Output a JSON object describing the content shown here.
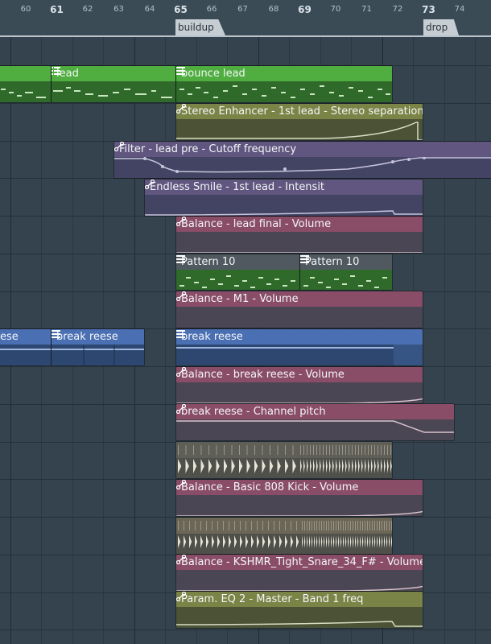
{
  "ruler": {
    "bars": [
      {
        "label": "60",
        "major": false
      },
      {
        "label": "61",
        "major": true
      },
      {
        "label": "62",
        "major": false
      },
      {
        "label": "63",
        "major": false
      },
      {
        "label": "64",
        "major": false
      },
      {
        "label": "65",
        "major": true
      },
      {
        "label": "66",
        "major": false
      },
      {
        "label": "67",
        "major": false
      },
      {
        "label": "68",
        "major": false
      },
      {
        "label": "69",
        "major": true
      },
      {
        "label": "70",
        "major": false
      },
      {
        "label": "71",
        "major": false
      },
      {
        "label": "72",
        "major": false
      },
      {
        "label": "73",
        "major": true
      },
      {
        "label": "74",
        "major": false
      }
    ],
    "markers": [
      "buildup",
      "drop"
    ]
  },
  "clips": {
    "lead_a": "lead",
    "lead_b": "bounce lead",
    "stereo": "Stereo Enhancer - 1st lead - Stereo separation",
    "filter": "Filter - lead pre - Cutoff frequency",
    "smile": "Endless Smile - 1st lead - Intensit",
    "bal_lead": "Balance - lead final - Volume",
    "pat_a": "Pattern 10",
    "pat_b": "Pattern 10",
    "bal_m1": "Balance - M1 - Volume",
    "reese_a": "ese",
    "reese_b": "break reese",
    "reese_c": "break reese",
    "bal_reese": "Balance - break reese - Volume",
    "pitch_reese": "break reese - Channel pitch",
    "bal_kick": "Balance - Basic 808 Kick - Volume",
    "bal_snare": "Balance - KSHMR_Tight_Snare_34_F# - Volume",
    "eq": "Param. EQ 2 - Master - Band 1 freq"
  },
  "colors": {
    "pattern_green": "#4fae3f",
    "pattern_blue": "#4a6fb3",
    "auto_olive": "#7a8446",
    "auto_purple": "#60567f",
    "auto_mauve": "#8a4d67",
    "pattern_grey": "#50595f"
  }
}
